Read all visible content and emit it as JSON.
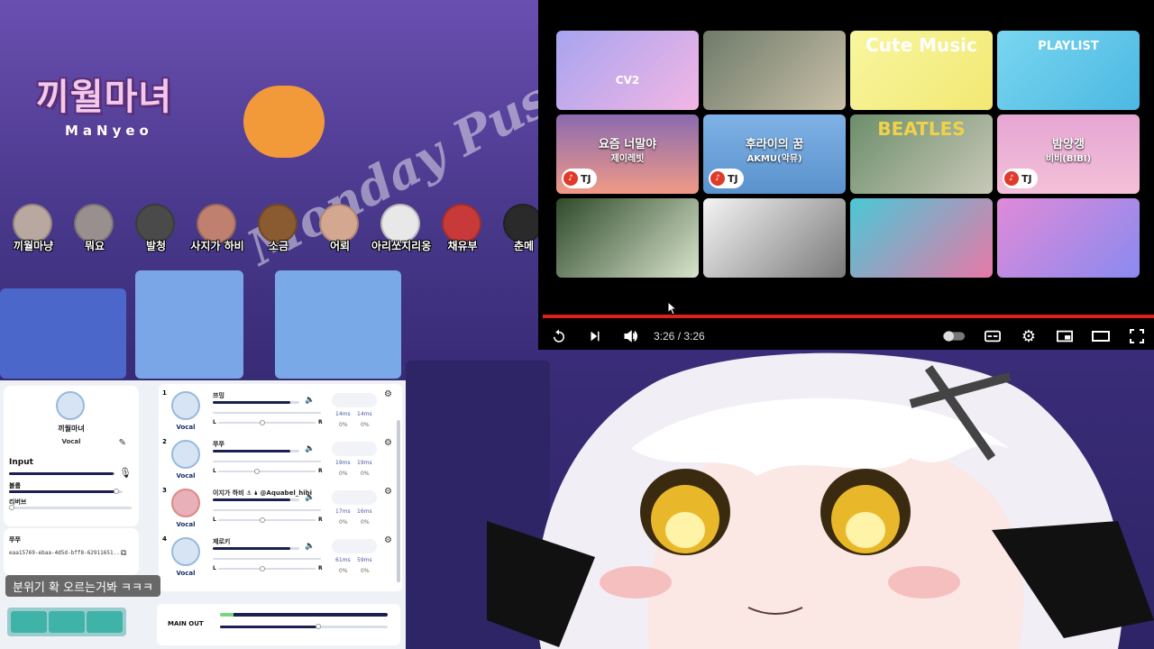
{
  "stream": {
    "logo_title": "끼월마녀",
    "logo_subtitle": "MaNyeo",
    "overlay_text": "Monday Pushes!"
  },
  "members": [
    "끼월마냥",
    "뭐요",
    "발청",
    "사지가 하비",
    "소금",
    "어뢰",
    "아리쏘지리옹",
    "채유부",
    "춘메"
  ],
  "player": {
    "tiles": [
      {
        "title": "",
        "sub": "",
        "badge": "",
        "label": "CV2"
      },
      {
        "title": "",
        "sub": "",
        "badge": "",
        "label": ""
      },
      {
        "title": "",
        "sub": "",
        "badge": "",
        "label": "Cute Music"
      },
      {
        "title": "",
        "sub": "",
        "badge": "",
        "label": "PLAYLIST"
      },
      {
        "title": "요즘 너말야",
        "sub": "제이레빗",
        "badge": "TJ",
        "label": ""
      },
      {
        "title": "후라이의 꿈",
        "sub": "AKMU(악뮤)",
        "badge": "TJ",
        "label": ""
      },
      {
        "title": "",
        "sub": "",
        "badge": "",
        "label": "BEATLES"
      },
      {
        "title": "밤양갱",
        "sub": "비비(BIBI)",
        "badge": "TJ",
        "label": ""
      },
      {
        "title": "",
        "sub": "",
        "badge": "",
        "label": ""
      },
      {
        "title": "",
        "sub": "",
        "badge": "",
        "label": ""
      },
      {
        "title": "",
        "sub": "",
        "badge": "",
        "label": ""
      },
      {
        "title": "",
        "sub": "",
        "badge": "",
        "label": ""
      }
    ],
    "time": "3:26 / 3:26",
    "progress": 1.0
  },
  "mixer": {
    "self": {
      "name": "끼월마녀",
      "role": "Vocal",
      "input_label": "Input",
      "volume_label": "볼륨",
      "reverb_label": "리버브"
    },
    "user": {
      "name": "쭈쭈",
      "id": "eaa15769-ebaa-4d5d-bff8-62911651..."
    },
    "channels": [
      {
        "num": "1",
        "name": "쯔밍",
        "role": "Vocal",
        "lat_l": "14ms",
        "lat_r": "14ms",
        "pct_l": "0%",
        "pct_r": "0%",
        "volume": 0.9,
        "pan": 0.45
      },
      {
        "num": "2",
        "name": "쭈쭈",
        "role": "Vocal",
        "lat_l": "19ms",
        "lat_r": "19ms",
        "pct_l": "0%",
        "pct_r": "0%",
        "volume": 0.9,
        "pan": 0.4
      },
      {
        "num": "3",
        "name": "이지가 하비 ⚓ 🌢 @Aquabel_hibi",
        "role": "Vocal",
        "lat_l": "17ms",
        "lat_r": "16ms",
        "pct_l": "0%",
        "pct_r": "0%",
        "volume": 0.9,
        "pan": 0.45
      },
      {
        "num": "4",
        "name": "제로키",
        "role": "Vocal",
        "lat_l": "61ms",
        "lat_r": "59ms",
        "pct_l": "0%",
        "pct_r": "0%",
        "volume": 0.9,
        "pan": 0.45
      }
    ],
    "l_label": "L",
    "r_label": "R",
    "main_out_label": "MAIN OUT",
    "main_out": 1.0
  },
  "chat": {
    "message": "분위기 확 오르는거봐 ㅋㅋㅋ"
  },
  "colors": {
    "progress": "#e02020",
    "mixer_bg": "#eef1f6",
    "accent": "#1a2050"
  }
}
